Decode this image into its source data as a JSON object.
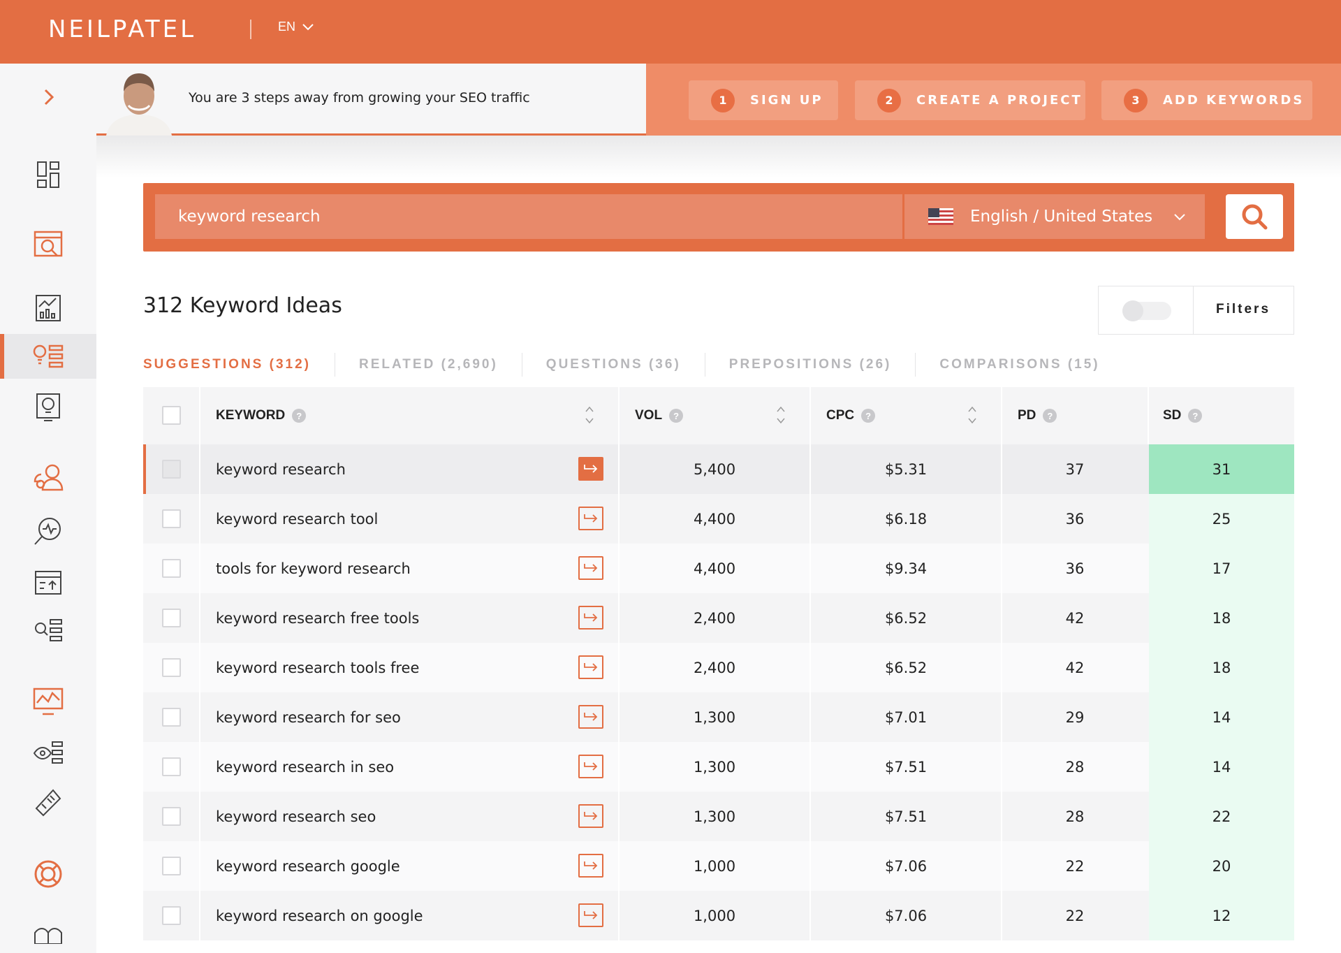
{
  "brand": {
    "logo": "NEILPATEL",
    "lang": "EN"
  },
  "promo": {
    "text": "You are 3 steps away from growing your SEO traffic"
  },
  "steps": [
    {
      "num": "1",
      "label": "SIGN UP"
    },
    {
      "num": "2",
      "label": "CREATE A PROJECT"
    },
    {
      "num": "3",
      "label": "ADD KEYWORDS"
    }
  ],
  "search": {
    "value": "keyword research",
    "locale": "English / United States"
  },
  "results": {
    "title": "312 Keyword Ideas",
    "filters_label": "Filters"
  },
  "tabs": [
    {
      "label": "SUGGESTIONS (312)",
      "active": true
    },
    {
      "label": "RELATED (2,690)",
      "active": false
    },
    {
      "label": "QUESTIONS (36)",
      "active": false
    },
    {
      "label": "PREPOSITIONS (26)",
      "active": false
    },
    {
      "label": "COMPARISONS (15)",
      "active": false
    }
  ],
  "table": {
    "headers": {
      "keyword": "KEYWORD",
      "vol": "VOL",
      "cpc": "CPC",
      "pd": "PD",
      "sd": "SD"
    },
    "rows": [
      {
        "keyword": "keyword research",
        "vol": "5,400",
        "cpc": "$5.31",
        "pd": "37",
        "sd": "31"
      },
      {
        "keyword": "keyword research tool",
        "vol": "4,400",
        "cpc": "$6.18",
        "pd": "36",
        "sd": "25"
      },
      {
        "keyword": "tools for keyword research",
        "vol": "4,400",
        "cpc": "$9.34",
        "pd": "36",
        "sd": "17"
      },
      {
        "keyword": "keyword research free tools",
        "vol": "2,400",
        "cpc": "$6.52",
        "pd": "42",
        "sd": "18"
      },
      {
        "keyword": "keyword research tools free",
        "vol": "2,400",
        "cpc": "$6.52",
        "pd": "42",
        "sd": "18"
      },
      {
        "keyword": "keyword research for seo",
        "vol": "1,300",
        "cpc": "$7.01",
        "pd": "29",
        "sd": "14"
      },
      {
        "keyword": "keyword research in seo",
        "vol": "1,300",
        "cpc": "$7.51",
        "pd": "28",
        "sd": "14"
      },
      {
        "keyword": "keyword research seo",
        "vol": "1,300",
        "cpc": "$7.51",
        "pd": "28",
        "sd": "22"
      },
      {
        "keyword": "keyword research google",
        "vol": "1,000",
        "cpc": "$7.06",
        "pd": "22",
        "sd": "20"
      },
      {
        "keyword": "keyword research on google",
        "vol": "1,000",
        "cpc": "$7.06",
        "pd": "22",
        "sd": "12"
      }
    ]
  },
  "colors": {
    "accent": "#e36e43",
    "sd_strong": "#9ee6c0",
    "sd_light": "#eafbf2"
  }
}
